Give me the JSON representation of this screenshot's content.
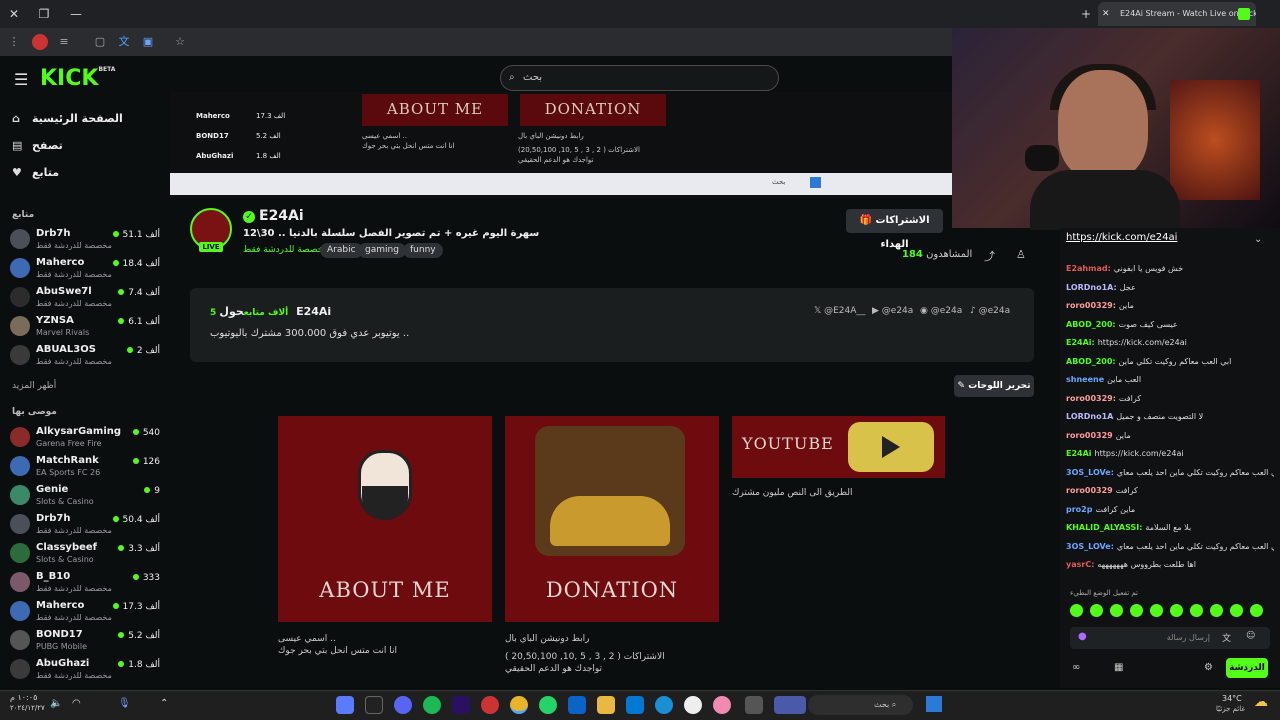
{
  "browser": {
    "tab_title": "E24Ai Stream - Watch Live on Kick",
    "new_tab": "+",
    "tab_close": "✕"
  },
  "header": {
    "logo": "KICK",
    "logo_beta": "BETA",
    "search_placeholder": "بحث"
  },
  "sidebar": {
    "nav": [
      {
        "label": "الصفحة الرئيسية",
        "icon": "home-icon"
      },
      {
        "label": "تصفح",
        "icon": "browse-icon"
      },
      {
        "label": "متابع",
        "icon": "heart-icon"
      }
    ],
    "following_title": "متابع",
    "following": [
      {
        "name": "Drb7h",
        "cat": "مخصصة للدردشة فقط",
        "viewers": "51.1 ألف"
      },
      {
        "name": "Maherco",
        "cat": "مخصصة للدردشة فقط",
        "viewers": "18.4 ألف"
      },
      {
        "name": "AbuSwe7l",
        "cat": "مخصصة للدردشة فقط",
        "viewers": "7.4 ألف"
      },
      {
        "name": "YZNSA",
        "cat": "Marvel Rivals",
        "viewers": "6.1 ألف"
      },
      {
        "name": "ABUAL3OS",
        "cat": "مخصصة للدردشة فقط",
        "viewers": "2 ألف"
      }
    ],
    "show_more": "أظهر المزيد",
    "recommended_title": "موصى بها",
    "recommended": [
      {
        "name": "AlkysarGaming",
        "cat": "Garena Free Fire",
        "viewers": "540"
      },
      {
        "name": "MatchRank",
        "cat": "EA Sports FC 26",
        "viewers": "126"
      },
      {
        "name": "Genie",
        "cat": "Slots & Casino",
        "viewers": "9"
      },
      {
        "name": "Drb7h",
        "cat": "مخصصة للدردشة فقط",
        "viewers": "50.4 ألف"
      },
      {
        "name": "Classybeef",
        "cat": "Slots & Casino",
        "viewers": "3.3 ألف"
      },
      {
        "name": "B_B10",
        "cat": "مخصصة للدردشة فقط",
        "viewers": "333"
      },
      {
        "name": "Maherco",
        "cat": "مخصصة للدردشة فقط",
        "viewers": "17.3 ألف"
      },
      {
        "name": "BOND17",
        "cat": "PUBG Mobile",
        "viewers": "5.2 ألف"
      },
      {
        "name": "AbuGhazi",
        "cat": "مخصصة للدردشة فقط",
        "viewers": "1.8 ألف"
      }
    ]
  },
  "mini_preview": {
    "about": "ABOUT ME",
    "donation": "DONATION",
    "about_desc1": "اسمي عيسى ..",
    "about_desc2": "انا انت متس انحل بتي بحر جوك",
    "don_desc1": "رابط دونيشن الباي بال",
    "don_desc2": "الاشتراكات ( 2 , 3 , 5 ,10, 20,50,100)",
    "don_desc3": "تواجدك هو الدعم الحقيقي",
    "names": [
      "Maherco",
      "BOND17",
      "AbuGhazi"
    ],
    "nums": [
      "17.3 الف",
      "5.2 الف",
      "1.8 الف"
    ],
    "search": "بحث"
  },
  "channel": {
    "username": "E24Ai",
    "live": "LIVE",
    "stream_title": "سهرة اليوم غيره + تم تصوير الفصل سلسلة بالدنيا .. 30\\12",
    "category": "مخصصة للدردشة فقط",
    "tags": [
      "Arabic",
      "gaming",
      "funny"
    ],
    "gift_subs": "الاشتراكات الهداء",
    "viewers_label": "المشاهدون",
    "viewers": "184"
  },
  "about": {
    "heading": "حول E24Ai",
    "followers": "5 ألاف متابع",
    "desc": "يوتيوبر عدي فوق 300.000 مشترك باليوتيوب ..",
    "socials": [
      "@E24A__",
      "@e24a",
      "@e24a",
      "@e24a"
    ]
  },
  "panels": {
    "edit": "تحرير اللوحات",
    "items": [
      {
        "title": "ABOUT ME",
        "desc": [
          "اسمي عيسى ..",
          "انا انت متس انحل بتي بحر جوك"
        ]
      },
      {
        "title": "DONATION",
        "desc": [
          "رابط دونيشن الباي بال",
          "الاشتراكات ( 2 , 3 , 5 ,10, 20,50,100 )",
          "تواجدك هو الدعم الحقيقي"
        ]
      },
      {
        "title": "YOUTUBE",
        "desc": [
          "الطريق الى النص مليون مشترك"
        ]
      }
    ]
  },
  "chat": {
    "link": "https://kick.com/e24ai",
    "messages": [
      {
        "user": "E2ahmad:",
        "text": "خش فويس يا ابفوني",
        "color": "#e05b5b"
      },
      {
        "user": "LORDno1A:",
        "text": "عجل",
        "color": "#b9b9ff"
      },
      {
        "user": "roro00329:",
        "text": "ماين",
        "color": "#ff9c9c"
      },
      {
        "user": "ABOD_200:",
        "text": "عيسى كيف صوت",
        "color": "#53fc18"
      },
      {
        "user": "E24Ai:",
        "text": "https://kick.com/e24ai",
        "color": "#53fc18"
      },
      {
        "user": "ABOD_200:",
        "text": "ابي العب معاكم روكيت تكلي ماين",
        "color": "#53fc18"
      },
      {
        "user": "shneene",
        "text": "العب ماين",
        "color": "#6ba7ff"
      },
      {
        "user": "roro00329:",
        "text": "كرافت",
        "color": "#ff9c9c"
      },
      {
        "user": "LORDno1A",
        "text": "لا التصويت منصف و جميل",
        "color": "#b9b9ff"
      },
      {
        "user": "roro00329",
        "text": "ماين",
        "color": "#ff9c9c"
      },
      {
        "user": "E24Ai",
        "text": "https://kick.com/e24ai",
        "color": "#53fc18"
      },
      {
        "user": "3OS_LOVe:",
        "text": "ابي العب معاكم روكيت تكلي ماين احد يلعب معاي",
        "color": "#6ba7ff"
      },
      {
        "user": "roro00329",
        "text": "كرافت",
        "color": "#ff9c9c"
      },
      {
        "user": "pro2p",
        "text": "ماين كرافت",
        "color": "#6ba7ff"
      },
      {
        "user": "KHALID_ALYASSI:",
        "text": "بلا مع السلامة",
        "color": "#53fc18"
      },
      {
        "user": "3OS_LOVe:",
        "text": "ابي العب معاكم روكيت تكلي ماين احد يلعب معاي",
        "color": "#6ba7ff"
      },
      {
        "user": "yasrC:",
        "text": "اها طلعت بطرووس هههههههه",
        "color": "#e05b5b"
      }
    ],
    "emote_note": "تم تفعيل الوضع البطيء",
    "input_placeholder": "إرسال رسالة",
    "send": "الدردشة"
  },
  "taskbar": {
    "time": "١٠:٠٥ م",
    "date": "٢٠٢٤/١٢/٢٧",
    "search": "بحث",
    "weather_temp": "34°C",
    "weather_desc": "غائم جزئيًا"
  },
  "colors": {
    "accent": "#53fc18",
    "bg": "#0b0e0f",
    "panel": "#6d0b0e"
  }
}
